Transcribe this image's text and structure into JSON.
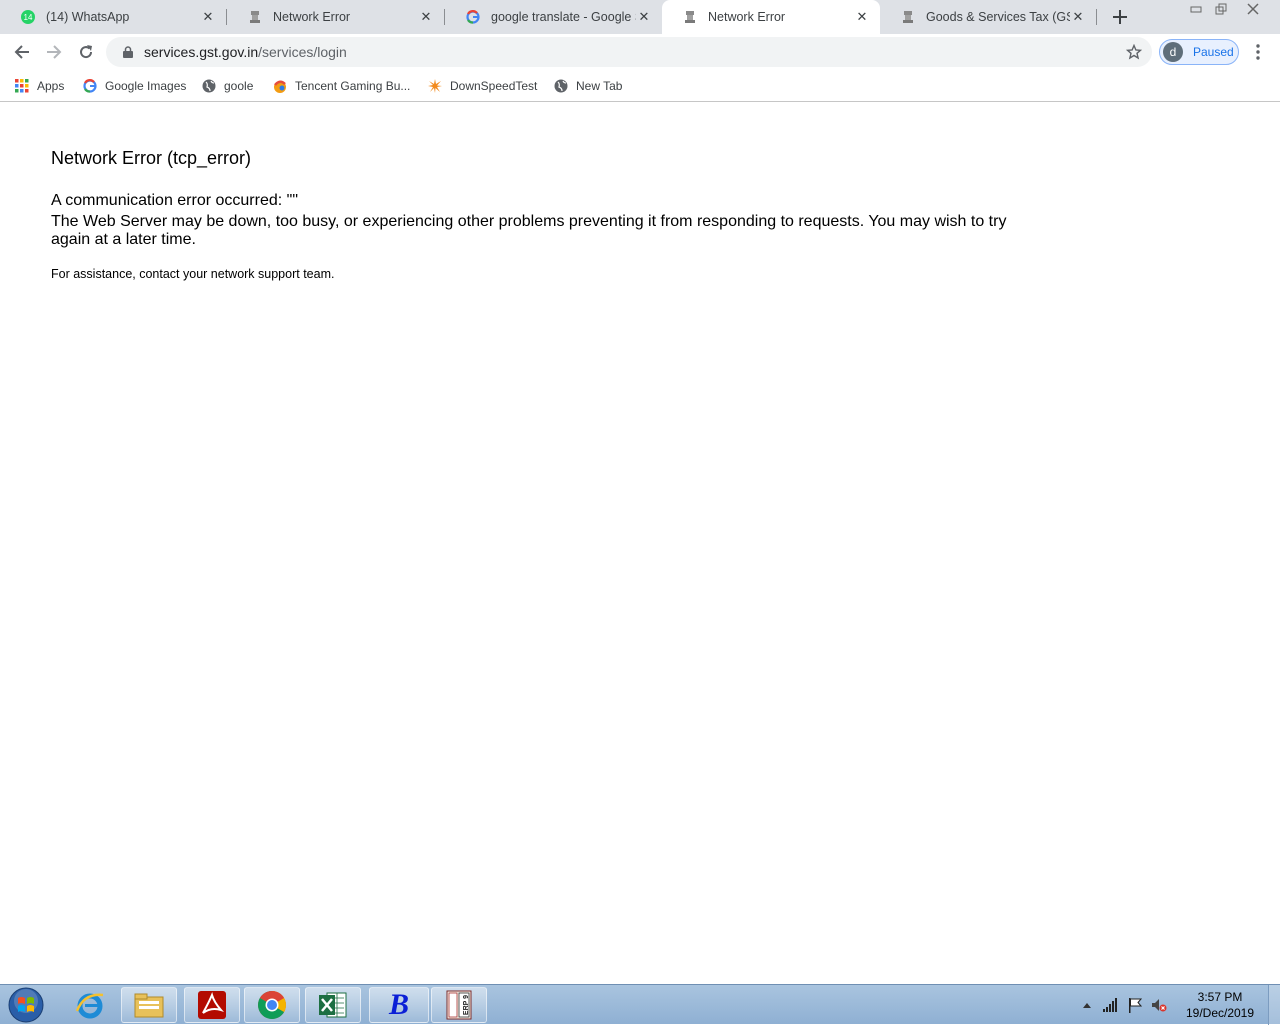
{
  "tabs": [
    {
      "title": "(14) WhatsApp",
      "badge": "14",
      "icon": "whatsapp-icon"
    },
    {
      "title": "Network Error",
      "icon": "emblem-icon"
    },
    {
      "title": "google translate - Google Search",
      "icon": "google-icon"
    },
    {
      "title": "Network Error",
      "icon": "emblem-icon",
      "active": true
    },
    {
      "title": "Goods & Services Tax (GST) | Login",
      "icon": "emblem-icon"
    }
  ],
  "toolbar": {
    "url_host": "services.gst.gov.in",
    "url_path": "/services/login",
    "profile_initial": "d",
    "profile_label": "Paused"
  },
  "bookmarks": [
    {
      "label": "Apps",
      "icon": "apps-grid-icon"
    },
    {
      "label": "Google Images",
      "icon": "google-icon"
    },
    {
      "label": "goole",
      "icon": "globe-icon"
    },
    {
      "label": "Tencent Gaming Bu...",
      "icon": "tencent-icon"
    },
    {
      "label": "DownSpeedTest",
      "icon": "starburst-icon"
    },
    {
      "label": "New Tab",
      "icon": "globe-icon"
    }
  ],
  "page": {
    "heading": "Network Error (tcp_error)",
    "message1": "A communication error occurred: \"\"",
    "message2": "The Web Server may be down, too busy, or experiencing other problems preventing it from responding to requests. You may wish to try again at a later time.",
    "assistance": "For assistance, contact your network support team."
  },
  "taskbar": {
    "time": "3:57 PM",
    "date": "19/Dec/2019",
    "tallyText": "Tally ERP 9",
    "bLetter": "B"
  },
  "colors": {
    "tabstrip": "#dee1e6",
    "omnibox": "#f1f3f4",
    "accent": "#1a73e8",
    "taskbar": "#9dbbd9"
  }
}
